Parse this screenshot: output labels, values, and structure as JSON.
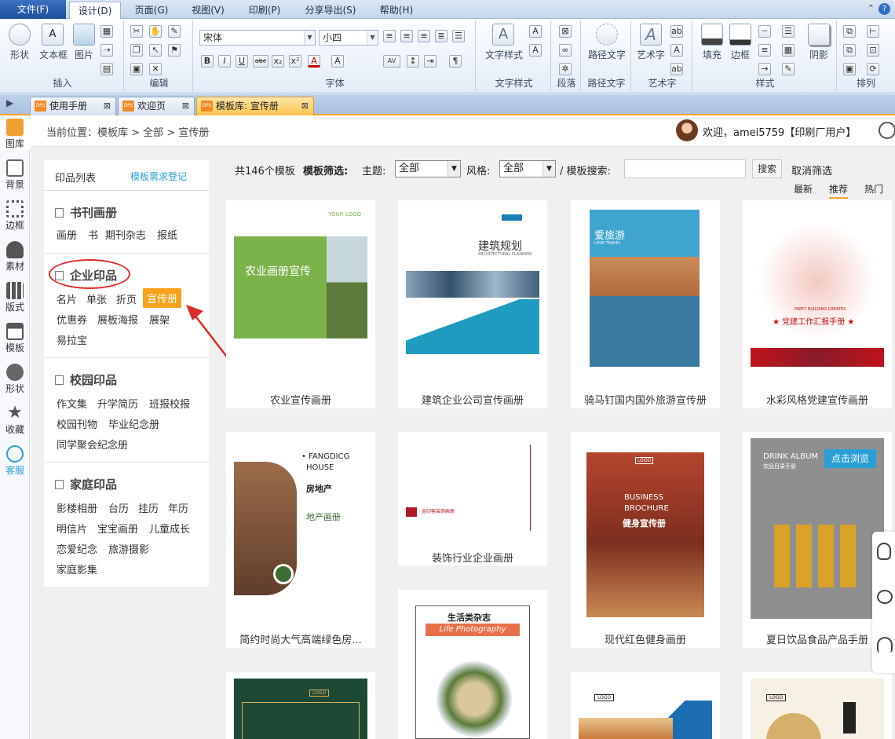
{
  "menu": {
    "tabs": [
      "文件(F)",
      "设计(D)",
      "页面(G)",
      "视图(V)",
      "印刷(P)",
      "分享导出(S)",
      "帮助(H)"
    ],
    "active_tab": "设计(D)",
    "help_icon": "help-icon"
  },
  "ribbon": {
    "groups": {
      "insert": {
        "label": "插入",
        "buttons": [
          "形状",
          "文本框",
          "图片"
        ]
      },
      "edit": {
        "label": "编辑"
      },
      "font": {
        "label": "字体",
        "font_name": "宋体",
        "font_size": "小四"
      },
      "paragraph": {
        "label": "段落"
      },
      "text_style": {
        "label": "文字样式",
        "button": "文字样式"
      },
      "path_text": {
        "label": "路径文字",
        "button": "路径文字"
      },
      "art_text": {
        "label": "艺术字",
        "button": "艺术字"
      },
      "style": {
        "label": "样式",
        "buttons": [
          "填充",
          "边框",
          "阴影"
        ]
      },
      "arrange": {
        "label": "排列"
      }
    },
    "format_buttons": [
      "B",
      "I",
      "U",
      "abc",
      "x₂",
      "x²",
      "A",
      "A"
    ],
    "quick_labels": [
      "段落"
    ]
  },
  "doc_tabs": [
    {
      "label": "使用手册",
      "active": false
    },
    {
      "label": "欢迎页",
      "active": false
    },
    {
      "label": "模板库: 宣传册",
      "active": true
    }
  ],
  "left_tools": [
    "图库",
    "背景",
    "边框",
    "素材",
    "版式",
    "模板",
    "形状",
    "收藏",
    "客服"
  ],
  "breadcrumb": "当前位置：模板库 > 全部 > 宣传册",
  "user": {
    "greeting": "欢迎，amei5759【印刷厂用户】"
  },
  "sidebar": {
    "title": "印品列表",
    "register_link": "模板需求登记",
    "sections": [
      {
        "name": "书刊画册",
        "items": [
          "画册",
          "书",
          "期刊杂志",
          "报纸"
        ]
      },
      {
        "name": "企业印品",
        "items": [
          "名片",
          "单张",
          "折页",
          "宣传册",
          "优惠券",
          "展板海报",
          "展架",
          "易拉宝"
        ]
      },
      {
        "name": "校园印品",
        "items": [
          "作文集",
          "升学简历",
          "班报校报",
          "校园刊物",
          "毕业纪念册",
          "同学聚会纪念册"
        ]
      },
      {
        "name": "家庭印品",
        "items": [
          "影楼相册",
          "台历",
          "挂历",
          "年历",
          "明信片",
          "宝宝画册",
          "儿童成长",
          "恋爱纪念",
          "旅游摄影",
          "家庭影集"
        ]
      }
    ],
    "selected_item": "宣传册"
  },
  "filter": {
    "count": "共146个模板",
    "filter_label": "模板筛选:",
    "theme_label": "主题:",
    "theme_value": "全部",
    "style_label": "风格:",
    "style_value": "全部",
    "search_label": "/ 模板搜索:",
    "search_button": "搜索",
    "clear": "取消筛选",
    "sort": [
      "最新",
      "推荐",
      "热门"
    ],
    "active_sort": "推荐"
  },
  "cards": [
    {
      "title": "农业宣传画册",
      "thumb_text": [
        "YOUR LOGO",
        "农业画册宣传"
      ]
    },
    {
      "title": "建筑企业公司宣传画册",
      "thumb_text": [
        "建筑规划",
        "ARCHITECTURAL PLANNING"
      ]
    },
    {
      "title": "骑马钉国内国外旅游宣传册",
      "thumb_text": [
        "爱旅游",
        "LOVE TRAVEL"
      ]
    },
    {
      "title": "水彩风格党建宣传画册",
      "thumb_text": [
        "★ 党建工作汇报手册 ★",
        "PARTY BUILDING CREATES"
      ]
    },
    {
      "title": "简约时尚大气高端绿色房...",
      "thumb_text": [
        "• FANGDICG",
        "HOUSE",
        "房地产",
        "地产画册"
      ]
    },
    {
      "title": "装饰行业企业画册",
      "thumb_text": [
        "金印客装饰画册"
      ]
    },
    {
      "title": "现代红色健身画册",
      "thumb_text": [
        "LOGO",
        "BUSINESS",
        "BROCHURE",
        "健身宣传册"
      ]
    },
    {
      "title": "夏日饮品食品产品手册",
      "thumb_text": [
        "DRINK ALBUM",
        "饮品目录手册"
      ],
      "hover_button": "点击浏览"
    },
    {
      "title": "",
      "thumb_text": [
        "LOGO"
      ]
    },
    {
      "title": "",
      "thumb_text": [
        "生活类杂志",
        "Life Photography"
      ]
    },
    {
      "title": "",
      "thumb_text": [
        "LOGO"
      ]
    },
    {
      "title": "",
      "thumb_text": [
        "LOGO"
      ]
    }
  ],
  "colors": {
    "accent": "#f5a623",
    "ribbon": "#dfe8f4",
    "link": "#2a9fd6",
    "selected_bg": "#f7a21b"
  }
}
